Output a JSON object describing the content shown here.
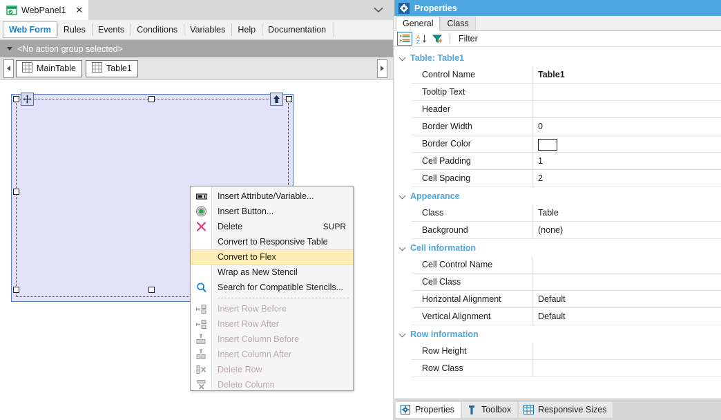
{
  "window": {
    "document_tab": {
      "label": "WebPanel1",
      "icon": "webpanel-icon",
      "close_label": "✕",
      "chevron": "chevron-down-icon"
    },
    "section_tabs": [
      {
        "label": "Web Form",
        "active": true
      },
      {
        "label": "Rules",
        "active": false
      },
      {
        "label": "Events",
        "active": false
      },
      {
        "label": "Conditions",
        "active": false
      },
      {
        "label": "Variables",
        "active": false
      },
      {
        "label": "Help",
        "active": false
      },
      {
        "label": "Documentation",
        "active": false
      }
    ],
    "action_group_bar": {
      "text": "<No action group selected>"
    },
    "breadcrumb": {
      "scroll_left": "scroll-left-arrow",
      "scroll_right": "scroll-right-arrow",
      "items": [
        {
          "label": "MainTable",
          "icon": "table-grid-icon"
        },
        {
          "label": "Table1",
          "icon": "table-grid-icon"
        }
      ]
    }
  },
  "canvas": {
    "selection": {
      "control": "Table1",
      "move_handle": "move-cross-icon",
      "parent_handle": "select-parent-arrow-icon"
    }
  },
  "context_menu": {
    "items": [
      {
        "label": "Insert Attribute/Variable...",
        "icon": "attribute-variable-icon",
        "shortcut": "",
        "disabled": false,
        "highlight": false
      },
      {
        "label": "Insert Button...",
        "icon": "button-icon",
        "shortcut": "",
        "disabled": false,
        "highlight": false
      },
      {
        "label": "Delete",
        "icon": "delete-x-icon",
        "shortcut": "SUPR",
        "disabled": false,
        "highlight": false
      },
      {
        "label": "Convert to Responsive Table",
        "icon": "",
        "shortcut": "",
        "disabled": false,
        "highlight": false
      },
      {
        "label": "Convert to Flex",
        "icon": "",
        "shortcut": "",
        "disabled": false,
        "highlight": true
      },
      {
        "label": "Wrap as New Stencil",
        "icon": "",
        "shortcut": "",
        "disabled": false,
        "highlight": false
      },
      {
        "label": "Search for Compatible Stencils...",
        "icon": "search-magnifier-icon",
        "shortcut": "",
        "disabled": false,
        "highlight": false
      },
      {
        "label": "Insert Row Before",
        "icon": "insert-row-before-icon",
        "shortcut": "",
        "disabled": true,
        "highlight": false
      },
      {
        "label": "Insert Row After",
        "icon": "insert-row-after-icon",
        "shortcut": "",
        "disabled": true,
        "highlight": false
      },
      {
        "label": "Insert Column Before",
        "icon": "insert-column-before-icon",
        "shortcut": "",
        "disabled": true,
        "highlight": false
      },
      {
        "label": "Insert Column After",
        "icon": "insert-column-after-icon",
        "shortcut": "",
        "disabled": true,
        "highlight": false
      },
      {
        "label": "Delete Row",
        "icon": "delete-row-icon",
        "shortcut": "",
        "disabled": true,
        "highlight": false
      },
      {
        "label": "Delete Column",
        "icon": "delete-column-icon",
        "shortcut": "",
        "disabled": true,
        "highlight": false
      }
    ],
    "separator_after_index": 6
  },
  "properties": {
    "title": "Properties",
    "title_icon": "gear-icon",
    "tabs": [
      {
        "label": "General",
        "active": true
      },
      {
        "label": "Class",
        "active": false
      }
    ],
    "toolbar": {
      "categorized_icon": "categorized-view-icon",
      "alphabetical_icon": "sort-az-icon",
      "filter_icon": "filter-funnel-icon",
      "filter_label": "Filter",
      "filter_value": "",
      "filter_placeholder": ""
    },
    "groups": [
      {
        "title": "Table: Table1",
        "rows": [
          {
            "name": "Control Name",
            "value": "Table1",
            "bold": true
          },
          {
            "name": "Tooltip Text",
            "value": "",
            "bold": false
          },
          {
            "name": "Header",
            "value": "",
            "bold": false
          },
          {
            "name": "Border Width",
            "value": "0",
            "bold": false
          },
          {
            "name": "Border Color",
            "value": "",
            "bold": false,
            "swatch": "#ffffff"
          },
          {
            "name": "Cell Padding",
            "value": "1",
            "bold": false
          },
          {
            "name": "Cell Spacing",
            "value": "2",
            "bold": false
          }
        ]
      },
      {
        "title": "Appearance",
        "rows": [
          {
            "name": "Class",
            "value": "Table",
            "bold": false
          },
          {
            "name": "Background",
            "value": "(none)",
            "bold": false
          }
        ]
      },
      {
        "title": "Cell information",
        "rows": [
          {
            "name": "Cell Control Name",
            "value": "",
            "bold": false
          },
          {
            "name": "Cell Class",
            "value": "",
            "bold": false
          },
          {
            "name": "Horizontal Alignment",
            "value": "Default",
            "bold": false
          },
          {
            "name": "Vertical Alignment",
            "value": "Default",
            "bold": false
          }
        ]
      },
      {
        "title": "Row information",
        "rows": [
          {
            "name": "Row Height",
            "value": "",
            "bold": false
          },
          {
            "name": "Row Class",
            "value": "",
            "bold": false
          }
        ]
      }
    ]
  },
  "dock_tabs": [
    {
      "label": "Properties",
      "icon": "gear-icon",
      "active": true
    },
    {
      "label": "Toolbox",
      "icon": "wrench-icon",
      "active": false
    },
    {
      "label": "Responsive Sizes",
      "icon": "table-grid-icon",
      "active": false
    }
  ],
  "colors": {
    "accent_blue": "#4ea6e0",
    "title_blue": "#1a7fc1",
    "selection_fill": "#e4e2f8",
    "selection_border": "#5b7fc7",
    "menu_highlight": "#fdeeb7",
    "action_bar": "#a6a6a6"
  }
}
